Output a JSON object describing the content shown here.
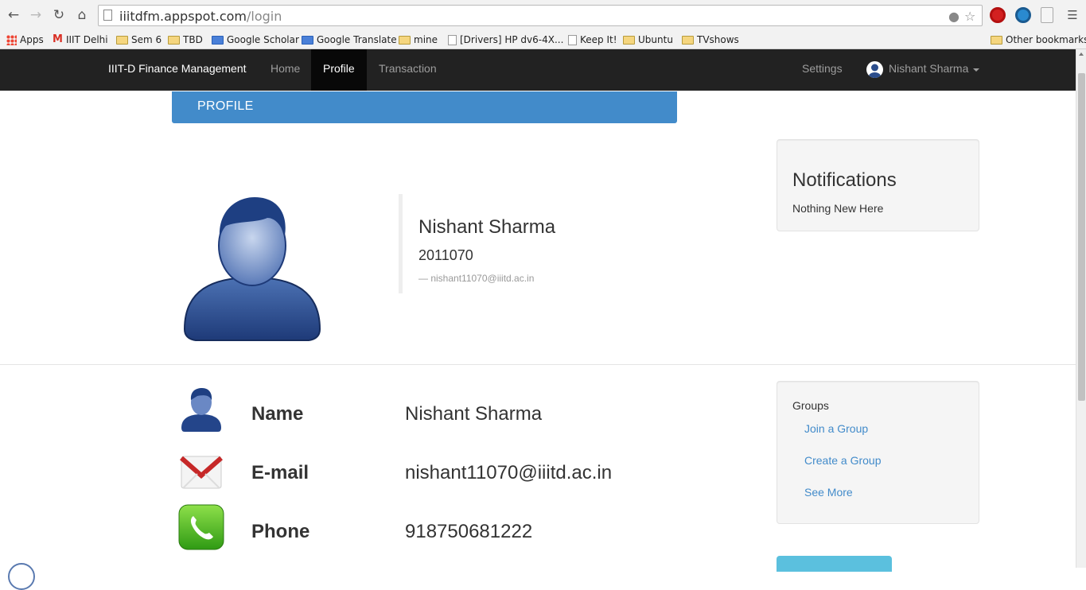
{
  "browser": {
    "url_host": "iiitdfm.appspot.com",
    "url_path": "/login",
    "bookmarks": [
      {
        "label": "Apps",
        "icon": "apps-icon"
      },
      {
        "label": "IIIT Delhi",
        "icon": "gmail-icon"
      },
      {
        "label": "Sem 6",
        "icon": "folder-icon"
      },
      {
        "label": "TBD",
        "icon": "folder-icon"
      },
      {
        "label": "Google Scholar",
        "icon": "scholar-icon"
      },
      {
        "label": "Google Translate",
        "icon": "translate-icon"
      },
      {
        "label": "mine",
        "icon": "folder-icon"
      },
      {
        "label": "[Drivers] HP dv6-4X...",
        "icon": "page-icon"
      },
      {
        "label": "Keep It!",
        "icon": "page-icon"
      },
      {
        "label": "Ubuntu",
        "icon": "folder-icon"
      },
      {
        "label": "TVshows",
        "icon": "folder-icon"
      }
    ],
    "other_bookmarks": "Other bookmarks"
  },
  "navbar": {
    "brand": "IIIT-D Finance Management",
    "links": [
      "Home",
      "Profile",
      "Transaction"
    ],
    "active": "Profile",
    "settings": "Settings",
    "user_name": "Nishant Sharma"
  },
  "profile": {
    "header": "PROFILE",
    "name": "Nishant Sharma",
    "roll": "2011070",
    "email_line": "— nishant11070@iiitd.ac.in"
  },
  "notifications": {
    "title": "Notifications",
    "text": "Nothing New Here"
  },
  "details": [
    {
      "label": "Name",
      "value": "Nishant Sharma",
      "icon": "user-icon"
    },
    {
      "label": "E-mail",
      "value": "nishant11070@iiitd.ac.in",
      "icon": "gmail-icon"
    },
    {
      "label": "Phone",
      "value": "918750681222",
      "icon": "phone-icon"
    }
  ],
  "groups": {
    "title": "Groups",
    "links": [
      "Join a Group",
      "Create a Group",
      "See More"
    ]
  },
  "colors": {
    "navbar_bg": "#222222",
    "primary": "#428bca",
    "info": "#5bc0de",
    "well_bg": "#f5f5f5"
  }
}
